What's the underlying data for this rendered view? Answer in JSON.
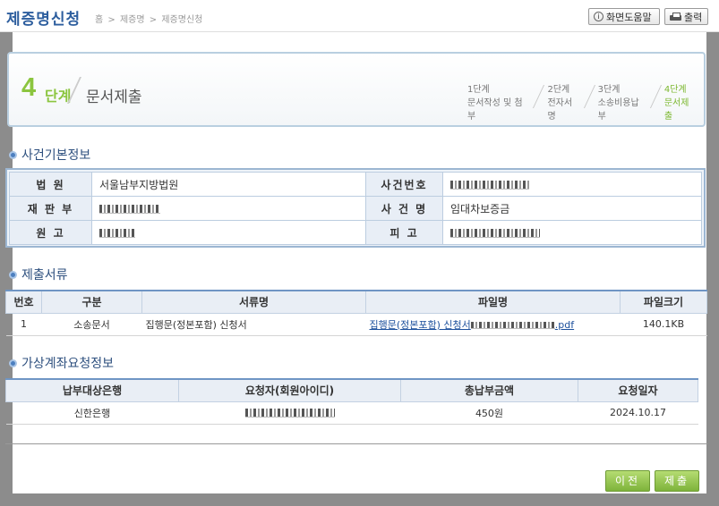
{
  "header": {
    "title": "제증명신청",
    "breadcrumb": [
      "홈",
      ">",
      "제증명",
      ">",
      "제증명신청"
    ],
    "help_label": "화면도움말",
    "print_label": "출력"
  },
  "step": {
    "number": "4",
    "word": "단계",
    "title": "문서제출",
    "steps": [
      {
        "line1": "1단계",
        "line2": "문서작성 및 첨부"
      },
      {
        "line1": "2단계",
        "line2": "전자서명"
      },
      {
        "line1": "3단계",
        "line2": "소송비용납부"
      },
      {
        "line1": "4단계",
        "line2": "문서제출"
      }
    ]
  },
  "case_section": {
    "title": "사건기본정보",
    "labels": {
      "court": "법 원",
      "case_no": "사건번호",
      "division": "재 판 부",
      "case_name": "사 건 명",
      "plaintiff": "원 고",
      "defendant": "피 고"
    },
    "values": {
      "court": "서울남부지방법원",
      "case_name": "임대차보증금"
    }
  },
  "docs_section": {
    "title": "제출서류",
    "headers": [
      "번호",
      "구분",
      "서류명",
      "파일명",
      "파일크기"
    ],
    "rows": [
      {
        "no": "1",
        "type": "소송문서",
        "name": "집행문(정본포함) 신청서",
        "file_prefix": "집행문(정본포함) 신청서",
        "file_suffix": ".pdf",
        "size": "140.1KB"
      }
    ]
  },
  "account_section": {
    "title": "가상계좌요청정보",
    "headers": [
      "납부대상은행",
      "요청자(회원아이디)",
      "총납부금액",
      "요청일자"
    ],
    "rows": [
      {
        "bank": "신한은행",
        "amount": "450원",
        "date": "2024.10.17"
      }
    ]
  },
  "actions": {
    "prev_label": "이전",
    "submit_label": "제출"
  },
  "colors": {
    "accent_green": "#8bc53f",
    "title_blue": "#2d5e9e",
    "link_blue": "#1b4f9c"
  }
}
